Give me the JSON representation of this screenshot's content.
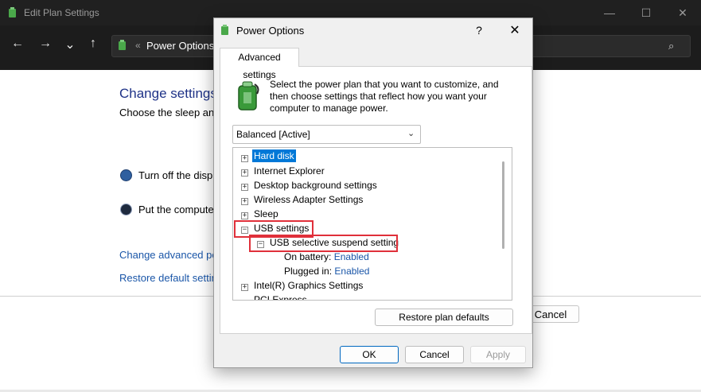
{
  "bg_window": {
    "title": "Edit Plan Settings",
    "address_sep": "«",
    "address": "Power Options",
    "heading": "Change settings f",
    "subheading": "Choose the sleep and c",
    "display_label": "Turn off the displa",
    "sleep_label": "Put the computer",
    "link_advanced": "Change advanced pow",
    "link_restore": "Restore default setting",
    "cancel_label": "Cancel",
    "controls": {
      "minimize": "—",
      "maximize": "☐",
      "close": "✕"
    },
    "nav": {
      "back": "←",
      "forward": "→",
      "recent": "⌄",
      "up": "↑",
      "search": "⌕"
    }
  },
  "dialog": {
    "title": "Power Options",
    "help": "?",
    "close": "✕",
    "tab": "Advanced settings",
    "description": "Select the power plan that you want to customize, and then choose settings that reflect how you want your computer to manage power.",
    "plan_selected": "Balanced [Active]",
    "tree": {
      "hard_disk": "Hard disk",
      "internet_explorer": "Internet Explorer",
      "desktop_background": "Desktop background settings",
      "wireless_adapter": "Wireless Adapter Settings",
      "sleep": "Sleep",
      "usb_settings": "USB settings",
      "usb_selective": "USB selective suspend setting",
      "on_battery_label": "On battery:",
      "on_battery_value": "Enabled",
      "plugged_in_label": "Plugged in:",
      "plugged_in_value": "Enabled",
      "intel_graphics": "Intel(R) Graphics Settings",
      "pci_express": "PCI Express"
    },
    "restore_button": "Restore plan defaults",
    "ok_button": "OK",
    "cancel_button": "Cancel",
    "apply_button": "Apply"
  },
  "colors": {
    "highlight": "#e0303a",
    "selection": "#0078d7",
    "link": "#1a56a8"
  }
}
